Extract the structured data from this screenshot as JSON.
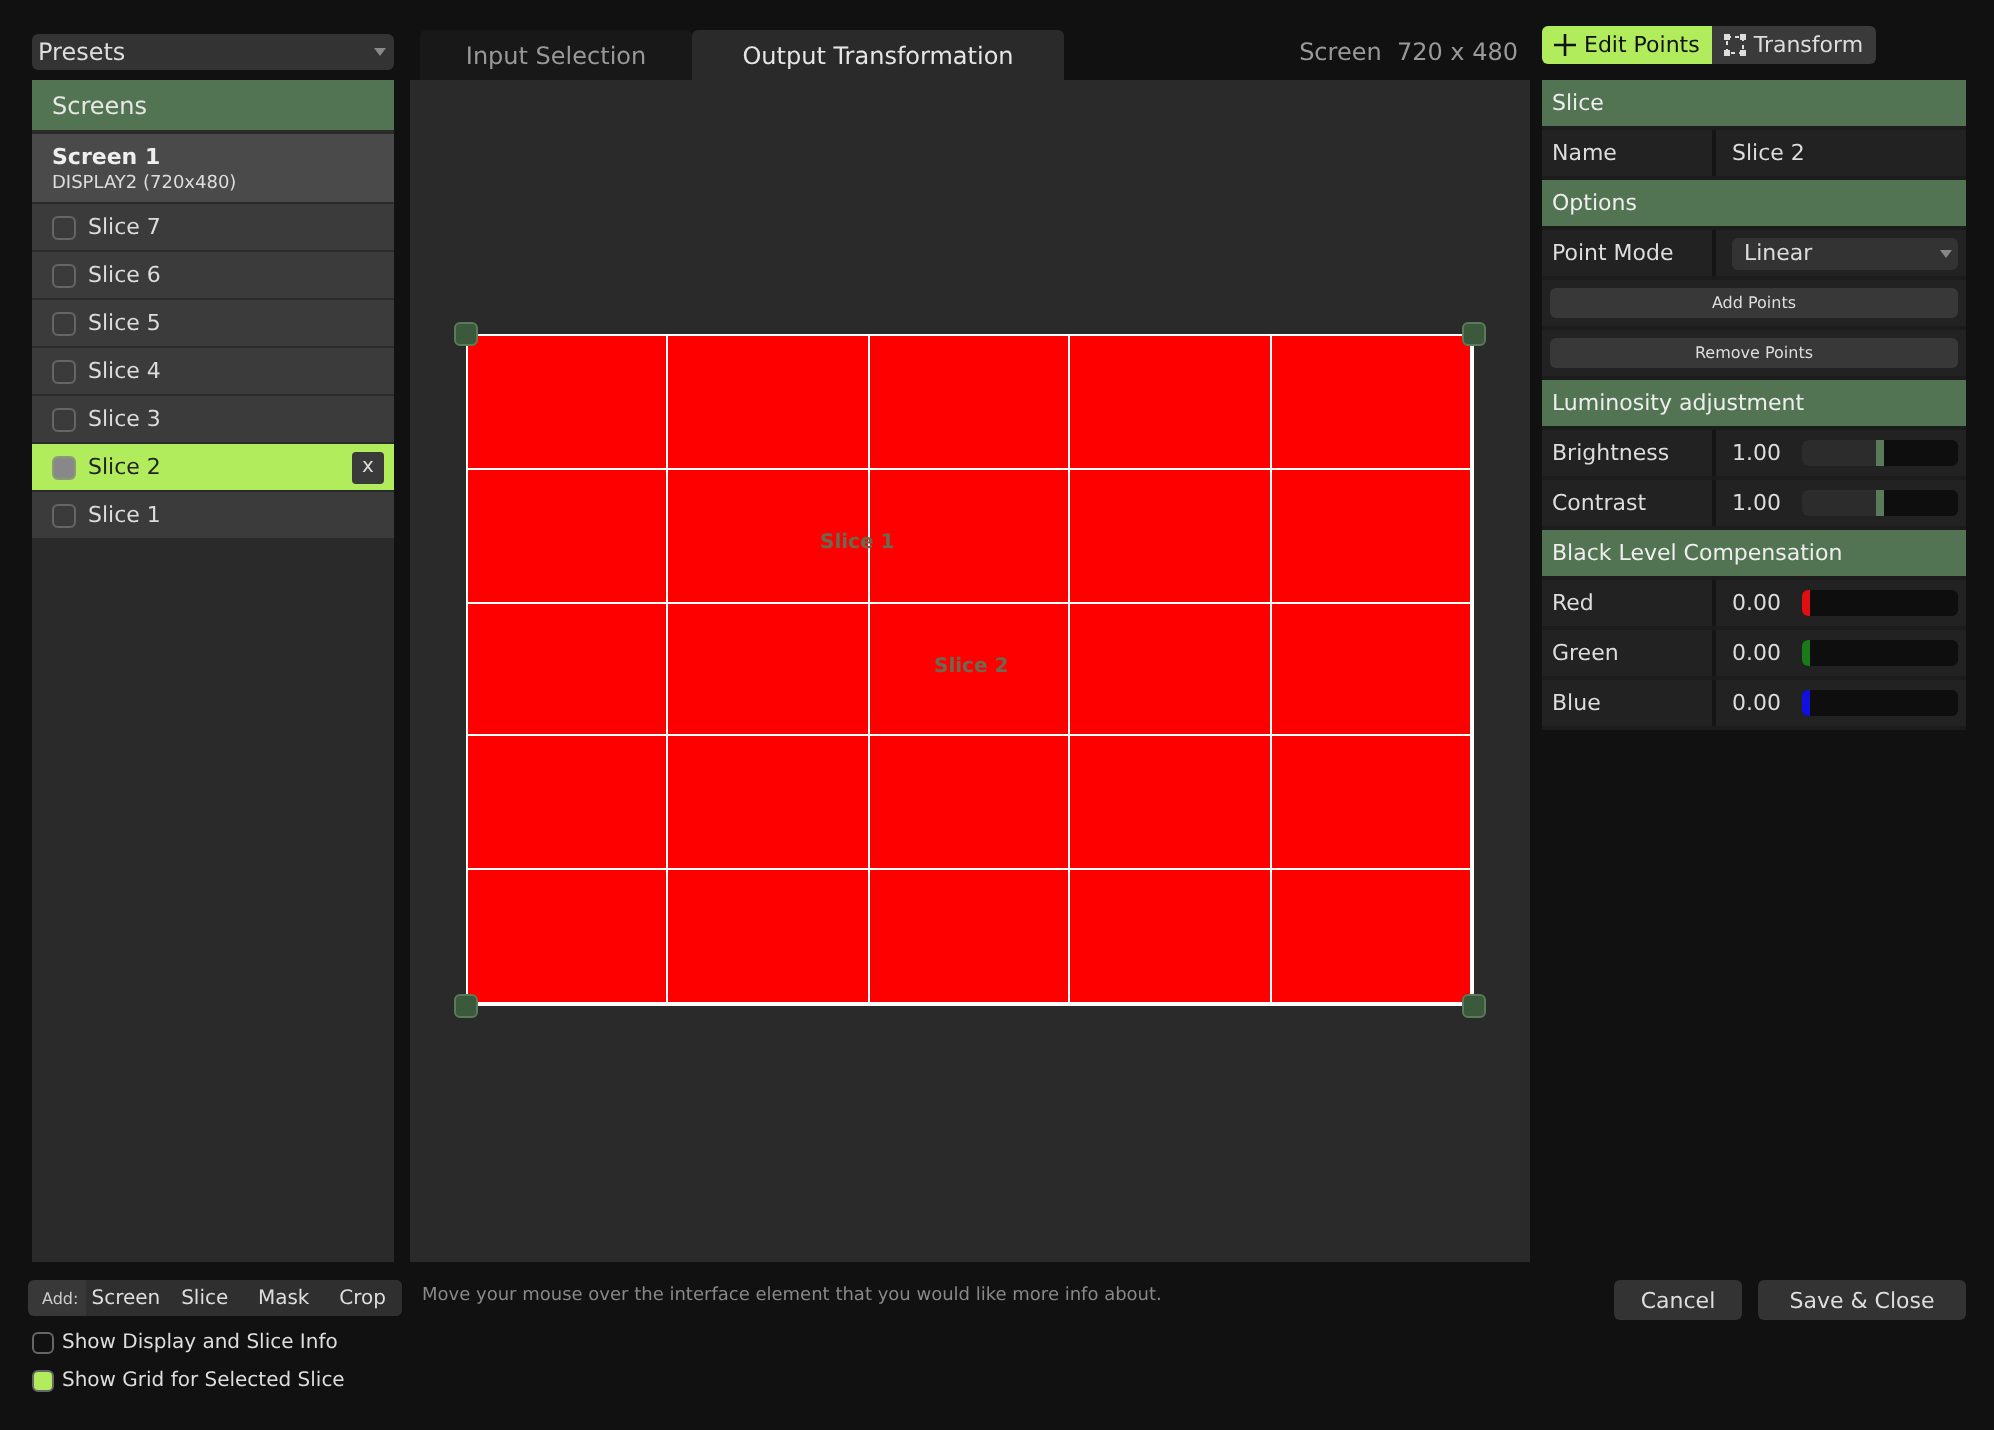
{
  "presets": {
    "value": "Presets"
  },
  "tabs": [
    {
      "label": "Input Selection",
      "selected": false
    },
    {
      "label": "Output Transformation",
      "selected": true
    }
  ],
  "screen_info": "Screen  720 x 480",
  "mode_buttons": [
    {
      "label": "Edit Points",
      "selected": true
    },
    {
      "label": "Transform",
      "selected": false
    }
  ],
  "screens": {
    "title": "Screens",
    "screen": {
      "name": "Screen 1",
      "display": "DISPLAY2 (720x480)"
    },
    "slices": [
      {
        "label": "Slice 7",
        "selected": false,
        "checked": false
      },
      {
        "label": "Slice 6",
        "selected": false,
        "checked": false
      },
      {
        "label": "Slice 5",
        "selected": false,
        "checked": false
      },
      {
        "label": "Slice 4",
        "selected": false,
        "checked": false
      },
      {
        "label": "Slice 3",
        "selected": false,
        "checked": false
      },
      {
        "label": "Slice 2",
        "selected": true,
        "checked": false,
        "delete": "x"
      },
      {
        "label": "Slice 1",
        "selected": false,
        "checked": false
      }
    ]
  },
  "canvas": {
    "labels": [
      {
        "text": "Slice 1"
      },
      {
        "text": "Slice 2"
      }
    ]
  },
  "add_bar": {
    "label": "Add:",
    "buttons": [
      "Screen",
      "Slice",
      "Mask",
      "Crop"
    ]
  },
  "options": [
    {
      "label": "Show Display and Slice Info",
      "checked": false
    },
    {
      "label": "Show Grid for Selected Slice",
      "checked": true
    }
  ],
  "hint": "Move your mouse over the interface element that you would like more info about.",
  "actions": [
    "Cancel",
    "Save & Close"
  ],
  "properties": [
    {
      "kind": "header",
      "label": "Slice"
    },
    {
      "kind": "text",
      "label": "Name",
      "value": "Slice 2"
    },
    {
      "kind": "header",
      "label": "Options"
    },
    {
      "kind": "select",
      "label": "Point Mode",
      "value": "Linear"
    },
    {
      "kind": "button",
      "label": "Add Points"
    },
    {
      "kind": "button",
      "label": "Remove Points"
    },
    {
      "kind": "header",
      "label": "Luminosity adjustment"
    },
    {
      "kind": "slider",
      "label": "Brightness",
      "reading": "1.00",
      "level": 0.5
    },
    {
      "kind": "slider",
      "label": "Contrast",
      "reading": "1.00",
      "level": 0.5
    },
    {
      "kind": "header",
      "label": "Black Level Compensation"
    },
    {
      "kind": "slider",
      "label": "Red",
      "reading": "0.00",
      "level": 0,
      "color": "#e01010"
    },
    {
      "kind": "slider",
      "label": "Green",
      "reading": "0.00",
      "level": 0,
      "color": "#1a7a1a"
    },
    {
      "kind": "slider",
      "label": "Blue",
      "reading": "0.00",
      "level": 0,
      "color": "#1010e0"
    }
  ]
}
